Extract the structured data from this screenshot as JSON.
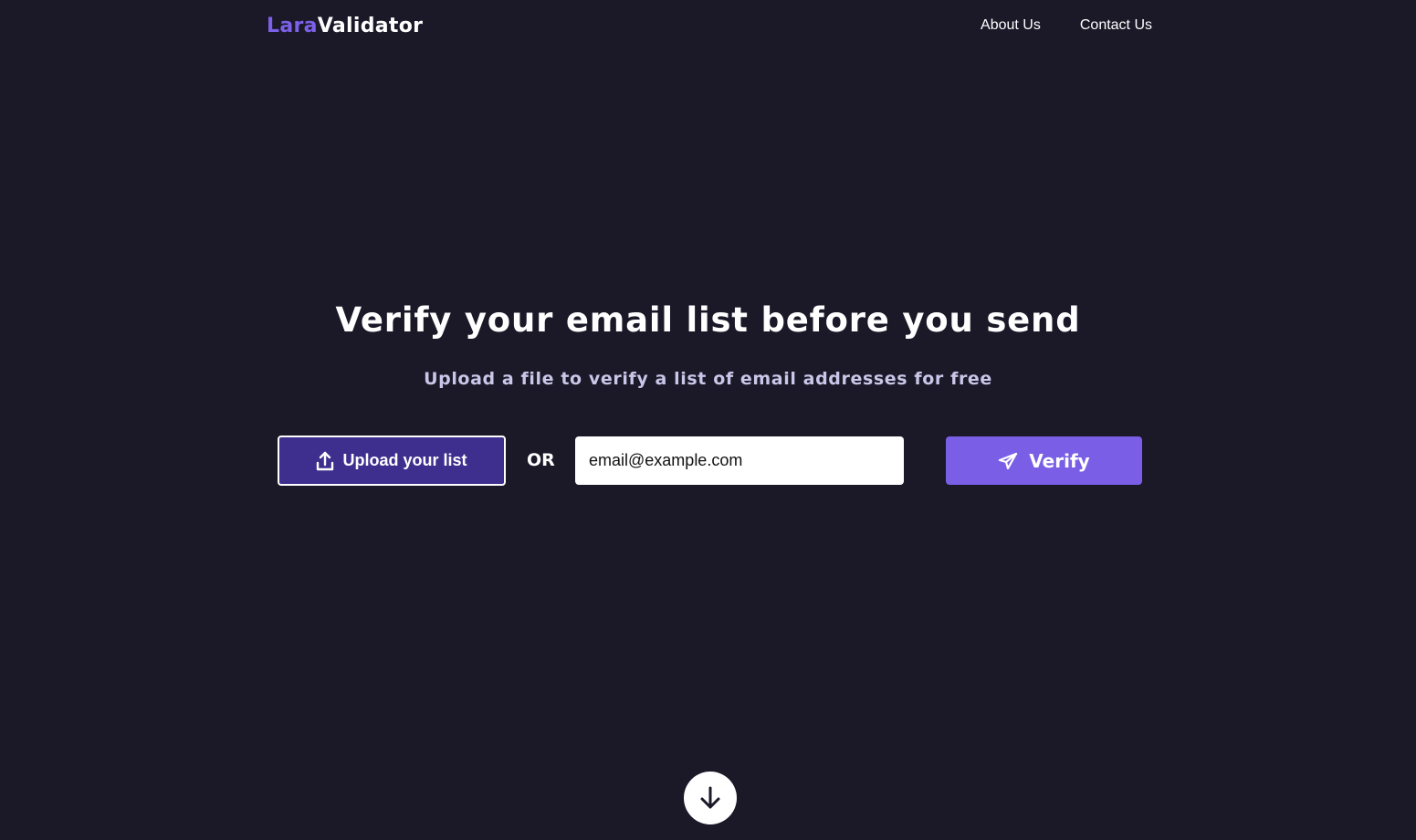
{
  "header": {
    "logo_part1": "Lara",
    "logo_part2": "Validator",
    "nav": {
      "about": "About Us",
      "contact": "Contact Us"
    }
  },
  "hero": {
    "title": "Verify your email list before you send",
    "subtitle": "Upload a file to verify a list of email addresses for free"
  },
  "form": {
    "upload_label": "Upload your list",
    "upload_icon": "upload-icon",
    "or_label": "OR",
    "email_placeholder": "email@example.com",
    "email_value": "",
    "verify_label": "Verify",
    "verify_icon": "paper-plane-icon"
  },
  "scroll": {
    "icon": "arrow-down-icon"
  },
  "colors": {
    "background": "#1b1828",
    "accent": "#7a5fe6",
    "logo_accent": "#7b61e8",
    "upload_button_bg": "#3e2f8f",
    "subtitle_text": "#c9c6e8"
  }
}
